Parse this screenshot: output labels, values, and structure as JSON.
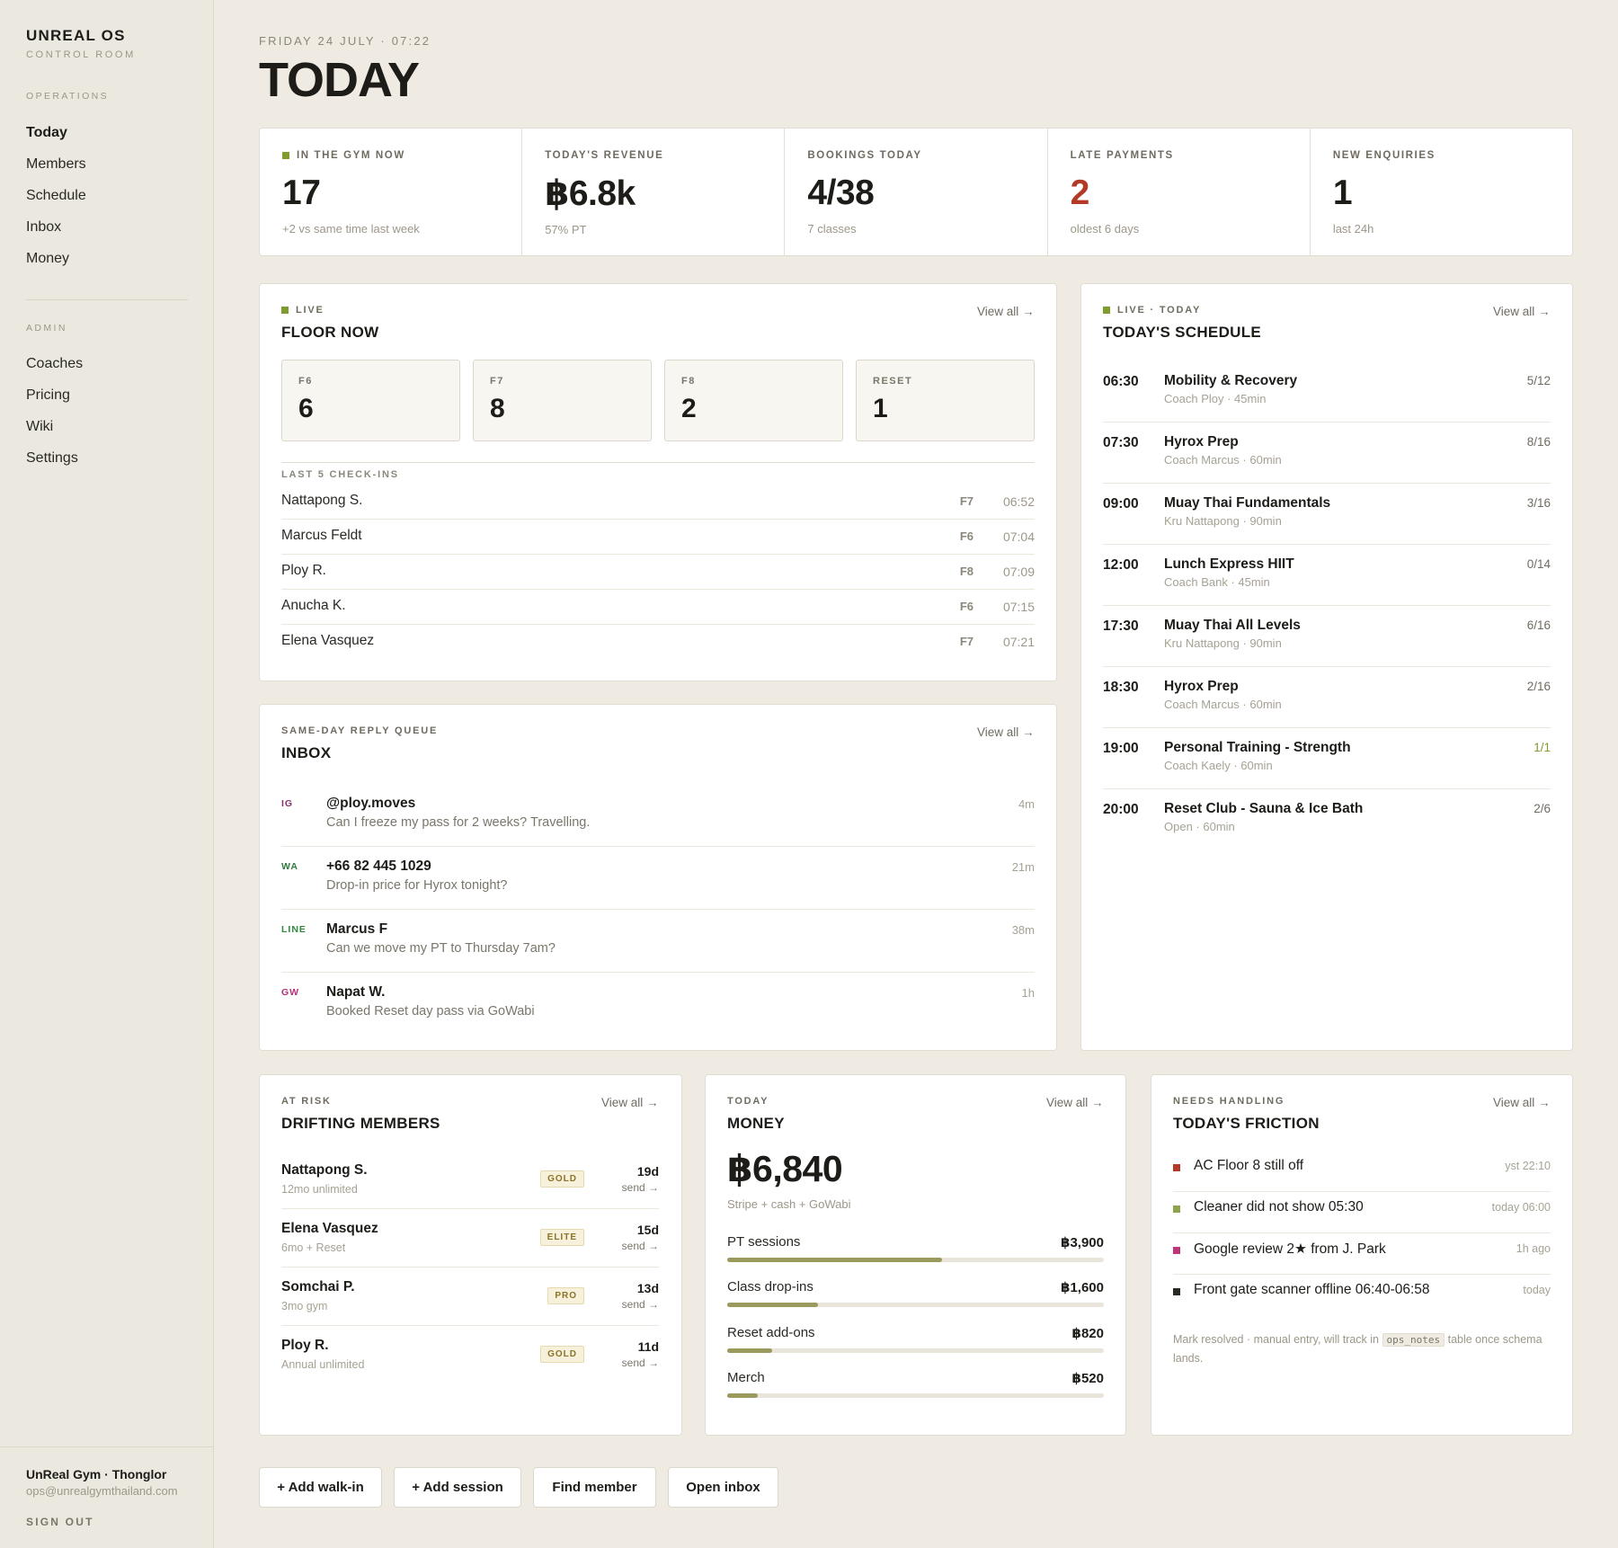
{
  "sidebar": {
    "brand": "UNREAL OS",
    "brand_sub": "CONTROL ROOM",
    "operations_label": "OPERATIONS",
    "operations": [
      "Today",
      "Members",
      "Schedule",
      "Inbox",
      "Money"
    ],
    "admin_label": "ADMIN",
    "admin": [
      "Coaches",
      "Pricing",
      "Wiki",
      "Settings"
    ],
    "gym_name": "UnReal Gym · Thonglor",
    "gym_email": "ops@unrealgymthailand.com",
    "sign_out": "SIGN OUT"
  },
  "header": {
    "date": "FRIDAY 24 JULY · 07:22",
    "title": "TODAY"
  },
  "kpis": [
    {
      "label": "IN THE GYM NOW",
      "value": "17",
      "sub": "+2 vs same time last week"
    },
    {
      "label": "TODAY'S REVENUE",
      "value": "฿6.8k",
      "sub": "57% PT"
    },
    {
      "label": "BOOKINGS TODAY",
      "value": "4/38",
      "sub": "7 classes"
    },
    {
      "label": "LATE PAYMENTS",
      "value": "2",
      "sub": "oldest 6 days"
    },
    {
      "label": "NEW ENQUIRIES",
      "value": "1",
      "sub": "last 24h"
    }
  ],
  "floor": {
    "eyebrow": "LIVE",
    "title": "FLOOR NOW",
    "view_all": "View all →",
    "zones": [
      {
        "label": "F6",
        "value": "6"
      },
      {
        "label": "F7",
        "value": "8"
      },
      {
        "label": "F8",
        "value": "2"
      },
      {
        "label": "RESET",
        "value": "1"
      }
    ],
    "checkins_label": "LAST 5 CHECK-INS",
    "checkins": [
      {
        "name": "Nattapong S.",
        "zone": "F7",
        "time": "06:52"
      },
      {
        "name": "Marcus Feldt",
        "zone": "F6",
        "time": "07:04"
      },
      {
        "name": "Ploy R.",
        "zone": "F8",
        "time": "07:09"
      },
      {
        "name": "Anucha K.",
        "zone": "F6",
        "time": "07:15"
      },
      {
        "name": "Elena Vasquez",
        "zone": "F7",
        "time": "07:21"
      }
    ]
  },
  "inbox": {
    "eyebrow": "SAME-DAY REPLY QUEUE",
    "title": "INBOX",
    "view_all": "View all →",
    "messages": [
      {
        "channel": "IG",
        "color": "#8a2f6e",
        "from": "@ploy.moves",
        "text": "Can I freeze my pass for 2 weeks? Travelling.",
        "age": "4m"
      },
      {
        "channel": "WA",
        "color": "#2f7a3f",
        "from": "+66 82 445 1029",
        "text": "Drop-in price for Hyrox tonight?",
        "age": "21m"
      },
      {
        "channel": "LINE",
        "color": "#2f8a3a",
        "from": "Marcus F",
        "text": "Can we move my PT to Thursday 7am?",
        "age": "38m"
      },
      {
        "channel": "GW",
        "color": "#b0307a",
        "from": "Napat W.",
        "text": "Booked Reset day pass via GoWabi",
        "age": "1h"
      }
    ]
  },
  "schedule": {
    "eyebrow": "LIVE · TODAY",
    "title": "TODAY'S SCHEDULE",
    "view_all": "View all →",
    "classes": [
      {
        "time": "06:30",
        "name": "Mobility & Recovery",
        "coach": "Coach Ploy · 45min",
        "cap": "5/12"
      },
      {
        "time": "07:30",
        "name": "Hyrox Prep",
        "coach": "Coach Marcus · 60min",
        "cap": "8/16"
      },
      {
        "time": "09:00",
        "name": "Muay Thai Fundamentals",
        "coach": "Kru Nattapong · 90min",
        "cap": "3/16"
      },
      {
        "time": "12:00",
        "name": "Lunch Express HIIT",
        "coach": "Coach Bank · 45min",
        "cap": "0/14"
      },
      {
        "time": "17:30",
        "name": "Muay Thai All Levels",
        "coach": "Kru Nattapong · 90min",
        "cap": "6/16"
      },
      {
        "time": "18:30",
        "name": "Hyrox Prep",
        "coach": "Coach Marcus · 60min",
        "cap": "2/16"
      },
      {
        "time": "19:00",
        "name": "Personal Training - Strength",
        "coach": "Coach Kaely · 60min",
        "cap": "1/1"
      },
      {
        "time": "20:00",
        "name": "Reset Club - Sauna & Ice Bath",
        "coach": "Open · 60min",
        "cap": "2/6"
      }
    ]
  },
  "drifting": {
    "eyebrow": "AT RISK",
    "title": "DRIFTING MEMBERS",
    "view_all": "View all →",
    "members": [
      {
        "name": "Nattapong S.",
        "plan": "12mo unlimited",
        "tier": "GOLD",
        "days": "19d",
        "send": "send →"
      },
      {
        "name": "Elena Vasquez",
        "plan": "6mo + Reset",
        "tier": "ELITE",
        "days": "15d",
        "send": "send →"
      },
      {
        "name": "Somchai P.",
        "plan": "3mo gym",
        "tier": "PRO",
        "days": "13d",
        "send": "send →"
      },
      {
        "name": "Ploy R.",
        "plan": "Annual unlimited",
        "tier": "GOLD",
        "days": "11d",
        "send": "send →"
      }
    ]
  },
  "money": {
    "eyebrow": "TODAY",
    "title": "MONEY",
    "view_all": "View all →",
    "total": "฿6,840",
    "sub": "Stripe + cash + GoWabi",
    "lines": [
      {
        "label": "PT sessions",
        "value": "฿3,900",
        "fraction": 0.57
      },
      {
        "label": "Class drop-ins",
        "value": "฿1,600",
        "fraction": 0.24
      },
      {
        "label": "Reset add-ons",
        "value": "฿820",
        "fraction": 0.12
      },
      {
        "label": "Merch",
        "value": "฿520",
        "fraction": 0.08
      }
    ]
  },
  "friction": {
    "eyebrow": "NEEDS HANDLING",
    "title": "TODAY'S FRICTION",
    "view_all": "View all →",
    "items": [
      {
        "text": "AC Floor 8 still off",
        "when": "yst 22:10",
        "color": "#b33a26"
      },
      {
        "text": "Cleaner did not show 05:30",
        "when": "today 06:00",
        "color": "#8fa34a"
      },
      {
        "text": "Google review 2★ from J. Park",
        "when": "1h ago",
        "color": "#c0357a"
      },
      {
        "text": "Front gate scanner offline 06:40-06:58",
        "when": "today",
        "color": "#2a2924"
      }
    ],
    "note_pre": "Mark resolved · manual entry, will track in",
    "note_code": "ops_notes",
    "note_post": "table once schema lands."
  },
  "actions": [
    "+ Add walk-in",
    "+ Add session",
    "Find member",
    "Open inbox"
  ]
}
